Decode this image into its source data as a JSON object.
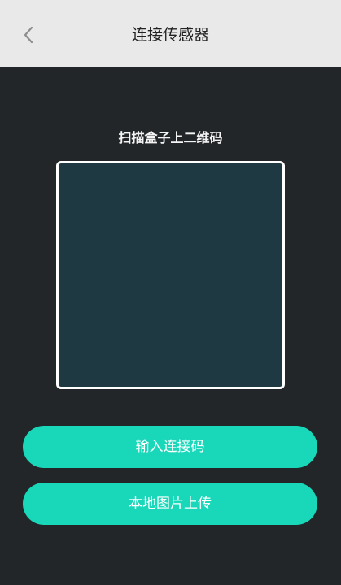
{
  "header": {
    "title": "连接传感器",
    "back_icon": "chevron-left-icon"
  },
  "scan": {
    "title": "扫描盒子上二维码"
  },
  "actions": {
    "input_code_label": "输入连接码",
    "upload_local_image_label": "本地图片上传"
  },
  "colors": {
    "header_bg": "#e9e9e9",
    "page_bg": "#222629",
    "scan_area_bg": "#1f3942",
    "button_accent": "#18d8b9"
  }
}
